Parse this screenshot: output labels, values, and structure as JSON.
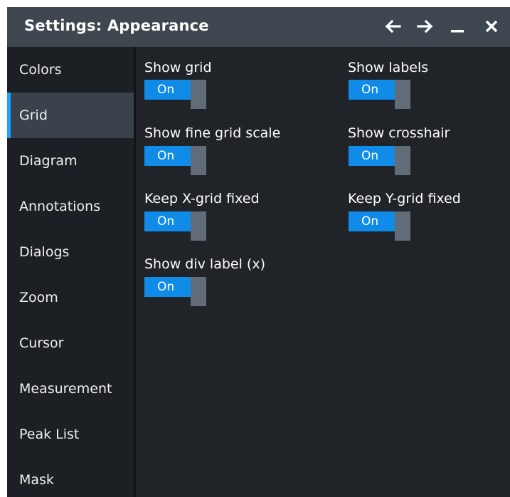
{
  "window": {
    "title": "Settings: Appearance",
    "buttons": {
      "back_icon": "arrow-left",
      "forward_icon": "arrow-right",
      "minimize_icon": "minimize",
      "close_icon": "close"
    }
  },
  "sidebar": {
    "items": [
      {
        "label": "Colors"
      },
      {
        "label": "Grid",
        "active": true
      },
      {
        "label": "Diagram"
      },
      {
        "label": "Annotations"
      },
      {
        "label": "Dialogs"
      },
      {
        "label": "Zoom"
      },
      {
        "label": "Cursor"
      },
      {
        "label": "Measurement"
      },
      {
        "label": "Peak List"
      },
      {
        "label": "Mask"
      }
    ]
  },
  "settings": {
    "show_grid": {
      "label": "Show grid",
      "value": "On"
    },
    "show_labels": {
      "label": "Show labels",
      "value": "On"
    },
    "show_fine_grid_scale": {
      "label": "Show fine grid scale",
      "value": "On"
    },
    "show_crosshair": {
      "label": "Show crosshair",
      "value": "On"
    },
    "keep_x_grid_fixed": {
      "label": "Keep X-grid fixed",
      "value": "On"
    },
    "keep_y_grid_fixed": {
      "label": "Keep Y-grid fixed",
      "value": "On"
    },
    "show_div_label_x": {
      "label": "Show div label (x)",
      "value": "On"
    }
  },
  "colors": {
    "title_bar": "#3e464f",
    "background": "#202428",
    "sidebar": "#1c2024",
    "active_item": "#3a434c",
    "accent": "#1aa3ff",
    "toggle_on": "#108ce8",
    "toggle_knob": "#616c78"
  }
}
